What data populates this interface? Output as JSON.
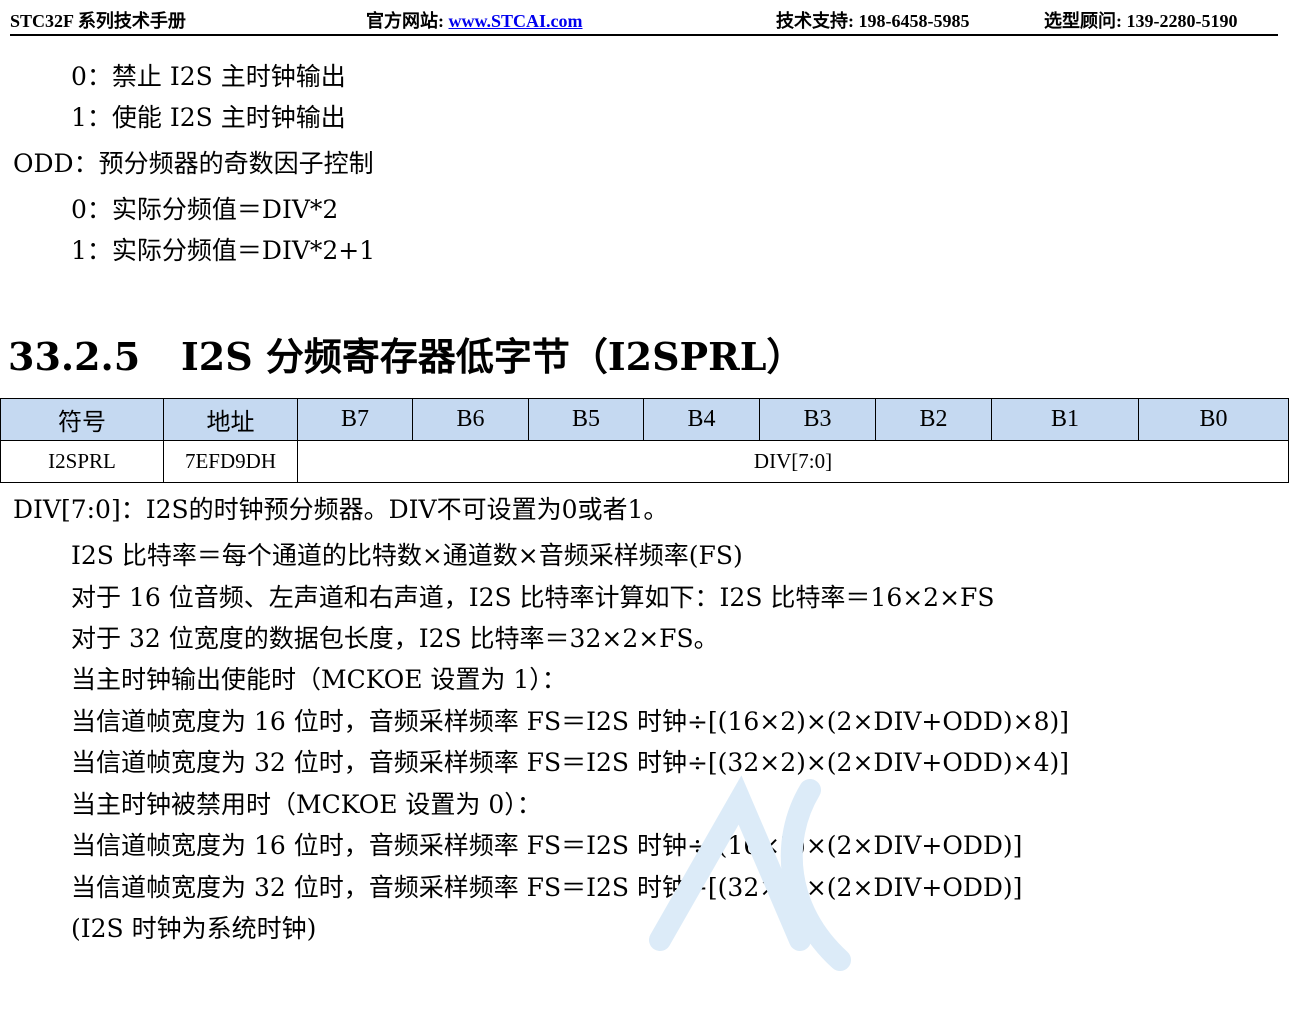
{
  "header": {
    "manual": "STC32F 系列技术手册",
    "website_label": "官方网站: ",
    "website_url": "www.STCAI.com",
    "support": "技术支持: 198-6458-5985",
    "consultant": "选型顾问: 139-2280-5190"
  },
  "top_lines": [
    "0：禁止 I2S 主时钟输出",
    "1：使能 I2S 主时钟输出",
    "ODD：预分频器的奇数因子控制",
    "0：实际分频值＝DIV*2",
    "1：实际分频值＝DIV*2+1"
  ],
  "section": {
    "number": "33.2.5",
    "title": "I2S 分频寄存器低字节（I2SPRL）"
  },
  "register_table": {
    "headers": [
      "符号",
      "地址",
      "B7",
      "B6",
      "B5",
      "B4",
      "B3",
      "B2",
      "B1",
      "B0"
    ],
    "symbol": "I2SPRL",
    "address": "7EFD9DH",
    "field": "DIV[7:0]"
  },
  "body_lines": [
    "DIV[7:0]：I2S的时钟预分频器。DIV不可设置为0或者1。",
    "I2S 比特率＝每个通道的比特数×通道数×音频采样频率(FS)",
    "对于 16 位音频、左声道和右声道，I2S 比特率计算如下：I2S 比特率＝16×2×FS",
    "对于 32 位宽度的数据包长度，I2S 比特率＝32×2×FS。",
    "当主时钟输出使能时（MCKOE 设置为 1）：",
    "当信道帧宽度为 16 位时，音频采样频率 FS＝I2S 时钟÷[(16×2)×(2×DIV+ODD)×8)]",
    "当信道帧宽度为 32 位时，音频采样频率 FS＝I2S 时钟÷[(32×2)×(2×DIV+ODD)×4)]",
    "当主时钟被禁用时（MCKOE 设置为 0）：",
    "当信道帧宽度为 16 位时，音频采样频率 FS＝I2S 时钟÷[(16×2)×(2×DIV+ODD)]",
    "当信道帧宽度为 32 位时，音频采样频率 FS＝I2S 时钟÷[(32×2)×(2×DIV+ODD)]",
    "(I2S 时钟为系统时钟)"
  ],
  "colors": {
    "table_header_bg": "#c5d9f1",
    "link": "#0000ee",
    "watermark": "#dcebf8"
  }
}
